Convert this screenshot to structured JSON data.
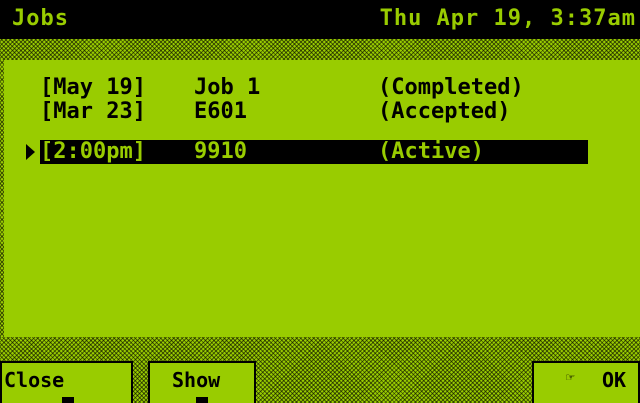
{
  "title_bar": {
    "title": "Jobs",
    "clock": "Thu Apr 19, 3:37am"
  },
  "jobs": [
    {
      "date": "[May 19]",
      "name": "Job 1",
      "status": "(Completed)"
    },
    {
      "date": "[Mar 23]",
      "name": "E601",
      "status": "(Accepted)"
    },
    {
      "date": "[2:00pm]",
      "name": "9910",
      "status": "(Active)",
      "selected": true
    }
  ],
  "softkeys": {
    "close": "Close",
    "show": "Show",
    "ok": "OK"
  },
  "icons": {
    "selection": "pointer-triangle-icon",
    "ok": "pointing-hand-icon"
  },
  "colors": {
    "lcd_green": "#99cc00",
    "ink": "#000000"
  }
}
